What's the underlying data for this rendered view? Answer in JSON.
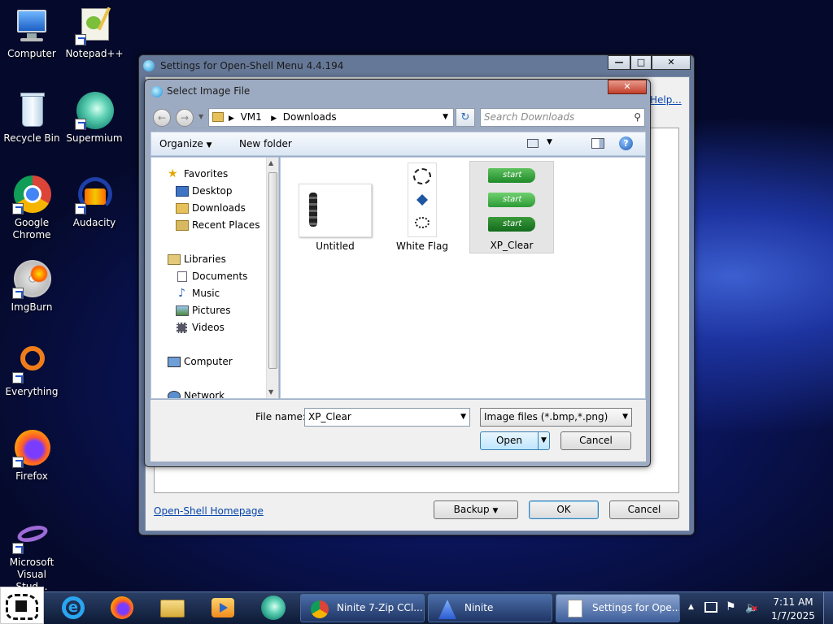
{
  "desktop": {
    "icons": [
      {
        "label": "Computer",
        "icon": "computer-icon"
      },
      {
        "label": "Notepad++",
        "icon": "notepadpp-icon"
      },
      {
        "label": "Recycle Bin",
        "icon": "recycle-bin-icon"
      },
      {
        "label": "Supermium",
        "icon": "supermium-icon"
      },
      {
        "label": "Google Chrome",
        "icon": "chrome-icon"
      },
      {
        "label": "Audacity",
        "icon": "audacity-icon"
      },
      {
        "label": "ImgBurn",
        "icon": "imgburn-icon"
      },
      {
        "label": "Everything",
        "icon": "everything-icon"
      },
      {
        "label": "Firefox",
        "icon": "firefox-icon"
      },
      {
        "label": "Microsoft Visual Stud...",
        "icon": "visual-studio-icon"
      }
    ]
  },
  "settings": {
    "title": "Settings for Open-Shell Menu 4.4.194",
    "help_link": "Help...",
    "homepage_link": "Open-Shell Homepage",
    "backup": "Backup",
    "ok": "OK",
    "cancel": "Cancel"
  },
  "dialog": {
    "title": "Select Image File",
    "breadcrumb": [
      "VM1",
      "Downloads"
    ],
    "search_placeholder": "Search Downloads",
    "organize": "Organize",
    "new_folder": "New folder",
    "nav": {
      "favorites": "Favorites",
      "desktop": "Desktop",
      "downloads": "Downloads",
      "recent": "Recent Places",
      "libraries": "Libraries",
      "documents": "Documents",
      "music": "Music",
      "pictures": "Pictures",
      "videos": "Videos",
      "computer": "Computer",
      "network": "Network"
    },
    "files": [
      "Untitled",
      "White Flag",
      "XP_Clear"
    ],
    "start_label": "start",
    "filename_label": "File name:",
    "filename_value": "XP_Clear",
    "filetype": "Image files (*.bmp,*.png)",
    "open": "Open",
    "cancel": "Cancel"
  },
  "taskbar": {
    "pinned": [
      "internet-explorer-icon",
      "firefox-icon",
      "explorer-icon",
      "media-player-icon",
      "supermium-icon"
    ],
    "buttons": [
      {
        "label": "Ninite 7-Zip CCl...",
        "icon": "chrome-icon"
      },
      {
        "label": "Ninite",
        "icon": "ninite-icon"
      },
      {
        "label": "Settings for Ope...",
        "icon": "document-icon"
      }
    ],
    "time": "7:11 AM",
    "date": "1/7/2025"
  },
  "colors": {
    "accent": "#3399ff",
    "desktop_bg": "#0a1458",
    "window_frame": "#7d8ca8"
  }
}
